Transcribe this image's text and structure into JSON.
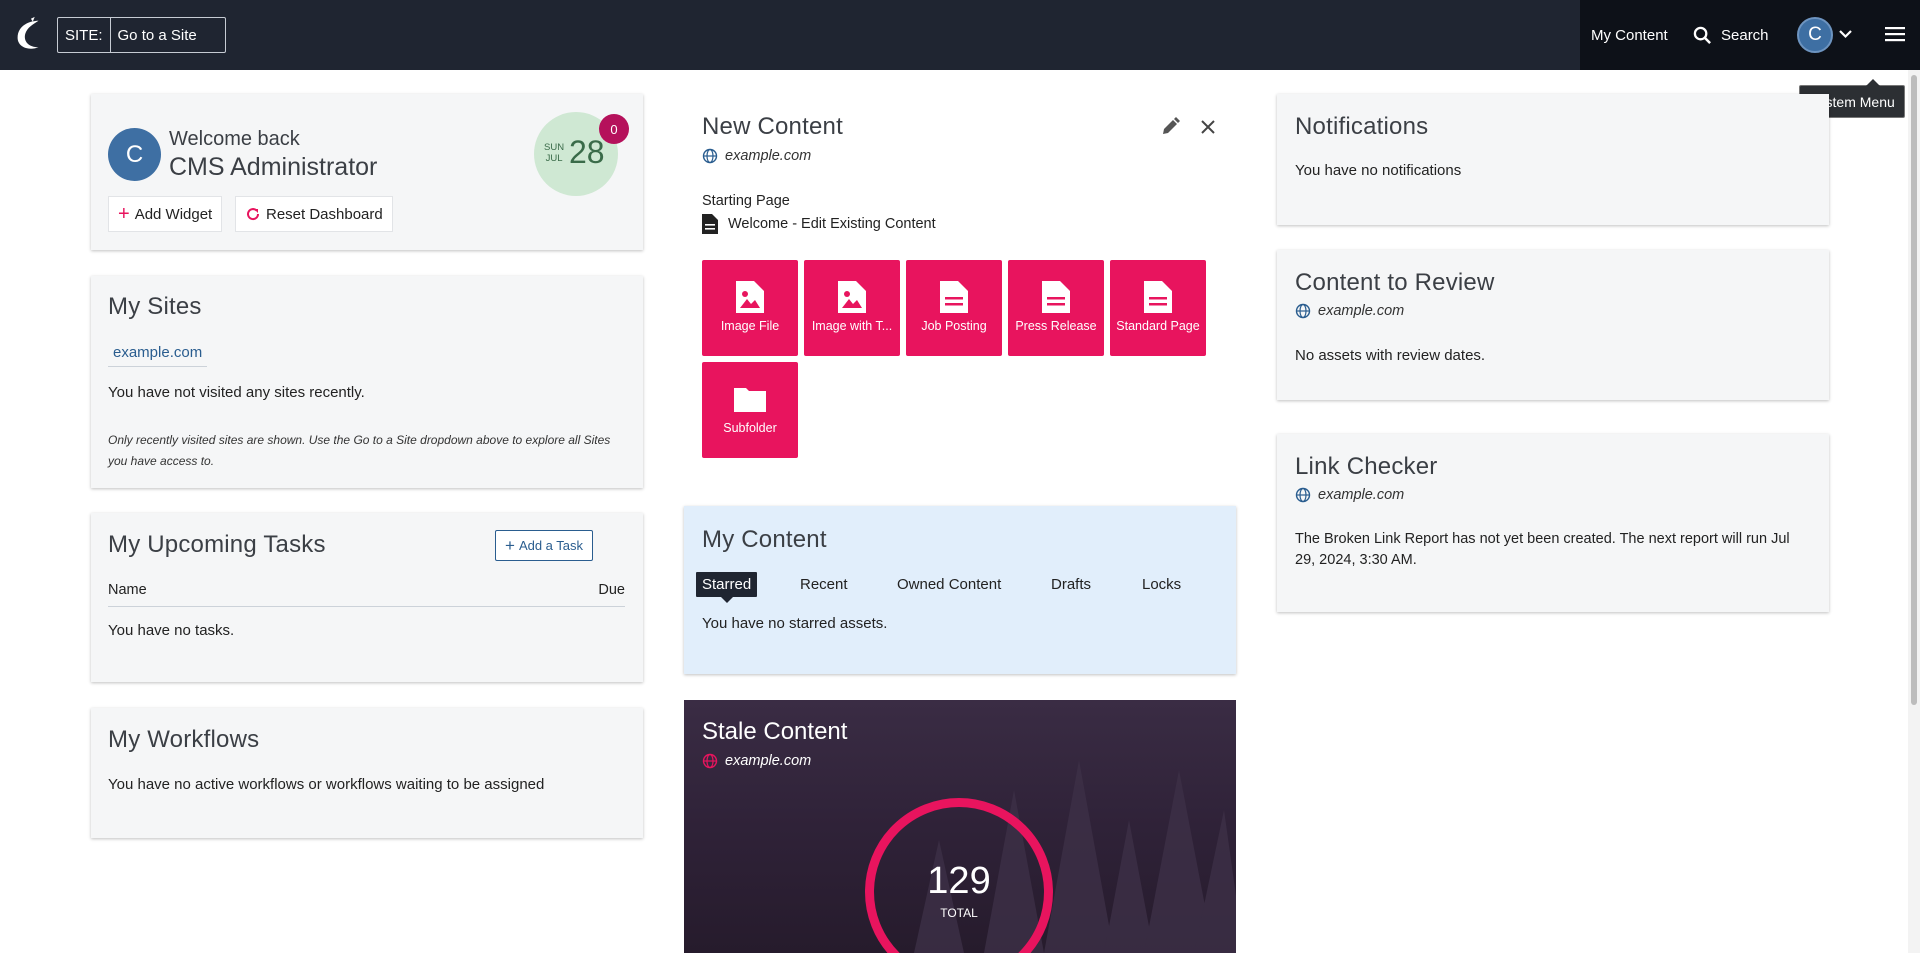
{
  "topbar": {
    "site_label": "SITE:",
    "site_value": "Go to a Site",
    "my_content": "My Content",
    "search": "Search",
    "avatar_initial": "C",
    "tooltip": "System Menu"
  },
  "welcome": {
    "avatar_initial": "C",
    "greeting": "Welcome back",
    "name": "CMS Administrator",
    "day": "SUN",
    "month": "JUL",
    "date": "28",
    "badge_count": "0",
    "add_widget": "Add Widget",
    "reset_dashboard": "Reset Dashboard"
  },
  "my_sites": {
    "title": "My Sites",
    "site": "example.com",
    "empty": "You have not visited any sites recently.",
    "note": "Only recently visited sites are shown. Use the Go to a Site dropdown above to explore all Sites you have access to."
  },
  "tasks": {
    "title": "My Upcoming Tasks",
    "add_task": "Add a Task",
    "col_name": "Name",
    "col_due": "Due",
    "empty": "You have no tasks."
  },
  "workflows": {
    "title": "My Workflows",
    "empty": "You have no active workflows or workflows waiting to be assigned"
  },
  "new_content": {
    "title": "New Content",
    "site": "example.com",
    "starting_label": "Starting Page",
    "starting_page": "Welcome - Edit Existing Content",
    "tiles": [
      {
        "label": "Image File",
        "icon": "image-file-icon"
      },
      {
        "label": "Image with T...",
        "icon": "image-file-icon"
      },
      {
        "label": "Job Posting",
        "icon": "document-icon"
      },
      {
        "label": "Press Release",
        "icon": "document-icon"
      },
      {
        "label": "Standard Page",
        "icon": "document-icon"
      },
      {
        "label": "Subfolder",
        "icon": "folder-icon"
      }
    ]
  },
  "my_content": {
    "title": "My Content",
    "tabs": [
      "Starred",
      "Recent",
      "Owned Content",
      "Drafts",
      "Locks"
    ],
    "empty": "You have no starred assets."
  },
  "stale": {
    "title": "Stale Content",
    "site": "example.com",
    "total": "129",
    "total_label": "TOTAL"
  },
  "notifications": {
    "title": "Notifications",
    "empty": "You have no notifications"
  },
  "review": {
    "title": "Content to Review",
    "site": "example.com",
    "empty": "No assets with review dates."
  },
  "link_checker": {
    "title": "Link Checker",
    "site": "example.com",
    "message": "The Broken Link Report has not yet been created. The next report will run Jul 29, 2024, 3:30 AM."
  },
  "colors": {
    "accent": "#e8145e",
    "topbar": "#1f2531",
    "avatar": "#3e6fa3",
    "link": "#2a5d8f"
  }
}
